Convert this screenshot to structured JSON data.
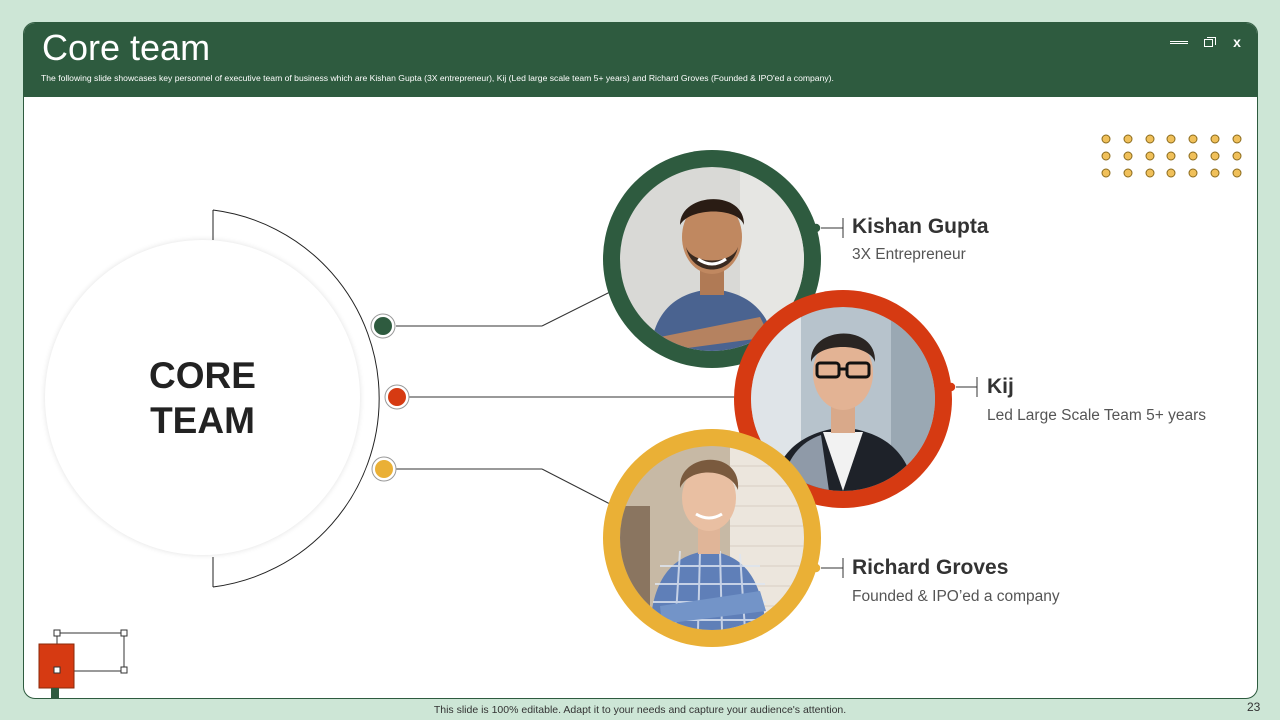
{
  "header": {
    "title": "Core team",
    "subtitle": "The  following slide showcases key personnel of executive team of business which are Kishan Gupta (3X entrepreneur),  Kij (Led large scale team 5+  years) and Richard Groves (Founded & IPO'ed a company)."
  },
  "window_controls": {
    "minimize": "minimize-icon",
    "maximize": "restore-icon",
    "close": "close-icon",
    "close_glyph": "x"
  },
  "center": {
    "line1": "CORE",
    "line2": "TEAM"
  },
  "members": [
    {
      "name": "Kishan Gupta",
      "role": "3X Entrepreneur",
      "color": "#2e5b3f"
    },
    {
      "name": "Kij",
      "role": "Led Large Scale Team 5+ years",
      "color": "#d63a12"
    },
    {
      "name": "Richard Groves",
      "role": "Founded & IPO’ed a company",
      "color": "#eab036"
    }
  ],
  "colors": {
    "green": "#2e5b3f",
    "red": "#d63a12",
    "yellow": "#eab036",
    "dots": "#eab036"
  },
  "footer": {
    "note": "This slide is 100% editable. Adapt it to your needs and capture your audience's attention.",
    "page": "23"
  }
}
